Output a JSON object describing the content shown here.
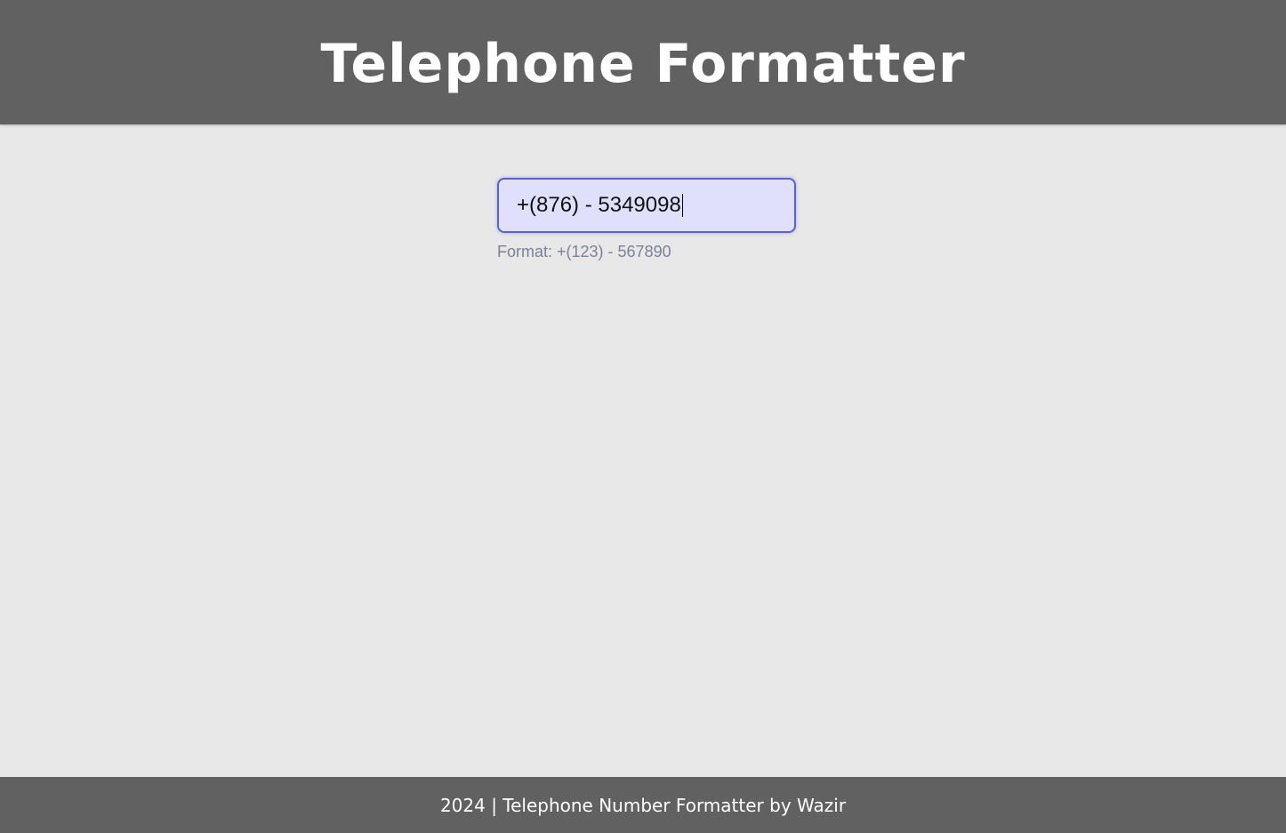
{
  "header": {
    "title": "Telephone Formatter"
  },
  "phone_input": {
    "value": "+(876) - 5349098",
    "format_hint": "Format: +(123) - 567890"
  },
  "footer": {
    "text": "2024 | Telephone Number Formatter by Wazir"
  },
  "colors": {
    "header_bg": "#616161",
    "page_bg": "#e8e8e8",
    "input_bg": "#e0e0fc",
    "input_border": "#5a62cc",
    "hint_text": "#7a8296"
  }
}
